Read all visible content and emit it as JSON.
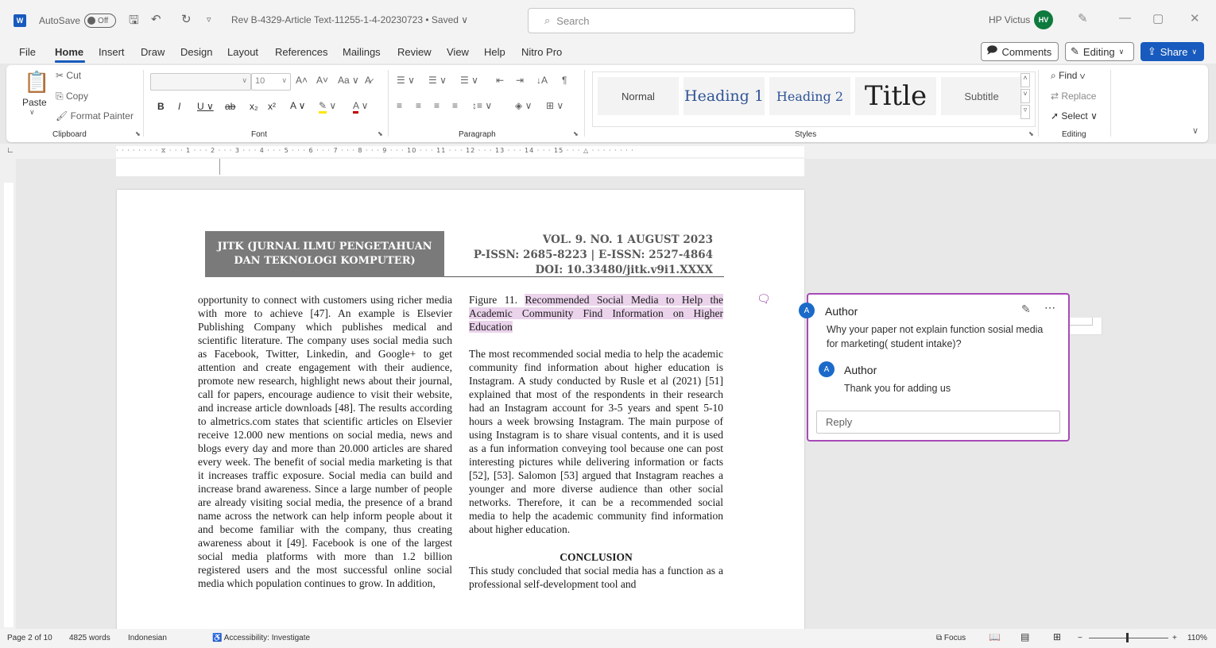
{
  "titlebar": {
    "app_icon": "W",
    "autosave_label": "AutoSave",
    "autosave_state": "Off",
    "doc_title": "Rev B-4329-Article Text-11255-1-4-20230723 • Saved ∨",
    "search_placeholder": "Search",
    "user_name": "HP Victus",
    "user_initials": "HV"
  },
  "menu": {
    "tabs": [
      "File",
      "Home",
      "Insert",
      "Draw",
      "Design",
      "Layout",
      "References",
      "Mailings",
      "Review",
      "View",
      "Help",
      "Nitro Pro"
    ],
    "comments_label": "Comments",
    "editing_label": "Editing",
    "share_label": "Share"
  },
  "ribbon": {
    "clipboard": {
      "paste": "Paste",
      "cut": "Cut",
      "copy": "Copy",
      "format_painter": "Format Painter",
      "label": "Clipboard"
    },
    "font": {
      "size": "10",
      "label": "Font"
    },
    "paragraph": {
      "label": "Paragraph"
    },
    "styles": {
      "items": [
        "Normal",
        "Heading 1",
        "Heading 2",
        "Title",
        "Subtitle"
      ],
      "label": "Styles"
    },
    "editing": {
      "find": "Find",
      "replace": "Replace",
      "select": "Select",
      "label": "Editing"
    }
  },
  "document": {
    "journal_name_1": "JITK (JURNAL ILMU PENGETAHUAN",
    "journal_name_2": "DAN TEKNOLOGI KOMPUTER)",
    "vol": "VOL. 9. NO. 1 AUGUST 2023",
    "issn": "P-ISSN: 2685-8223 | E-ISSN: 2527-4864",
    "doi": "DOI: 10.33480/jitk.v9i1.XXXX",
    "left_column": "opportunity to connect with customers using richer media with more to achieve [47]. An example is Elsevier Publishing Company which publishes medical and scientific literature. The company uses social media such as Facebook, Twitter, Linkedin, and Google+ to get attention and create engagement with their audience, promote new research, highlight news about their journal, call for papers, encourage audience to visit their website, and increase article downloads [48]. The results according to almetrics.com states that scientific articles on Elsevier receive 12.000 new mentions on social media, news and blogs every day and more than 20.000 articles are shared every week. The benefit of social media marketing is that it increases traffic exposure. Social media can build and increase brand awareness. Since a large number of people are already visiting social media, the presence of a brand name across the network can help inform people about it and become familiar with the company, thus creating awareness about it [49]. Facebook is one of the largest social media platforms with more than 1.2 billion registered users and the most successful online social media which population continues to grow. In addition,",
    "figure_prefix": "Figure 11. ",
    "figure_caption": "Recommended Social Media to Help the Academic Community Find Information on Higher Education",
    "right_para": "The most recommended social media to help the academic community find information about higher education is Instagram. A study conducted by Rusle et al (2021) [51] explained that most of the respondents in their research had an Instagram account for 3-5 years and spent 5-10 hours a week browsing Instagram. The main purpose of using Instagram is to share visual contents, and it is used as a fun information conveying tool because one can post interesting pictures while delivering information or facts [52], [53]. Salomon [53] argued that Instagram reaches a younger and more diverse audience than other social networks. Therefore, it can be a recommended social media to help the academic community find information about higher education.",
    "conclusion_heading": "CONCLUSION",
    "conclusion_text": "This study concluded that social media has a function as a professional self-development tool and"
  },
  "comment": {
    "author": "Author",
    "avatar": "A",
    "text": "Why your paper not explain function sosial media for marketing( student intake)?",
    "reply_author": "Author",
    "reply_text": "Thank you for adding us",
    "reply_placeholder": "Reply"
  },
  "statusbar": {
    "page": "Page 2 of 10",
    "words": "4825 words",
    "language": "Indonesian",
    "accessibility": "Accessibility: Investigate",
    "focus": "Focus",
    "zoom": "110%"
  }
}
